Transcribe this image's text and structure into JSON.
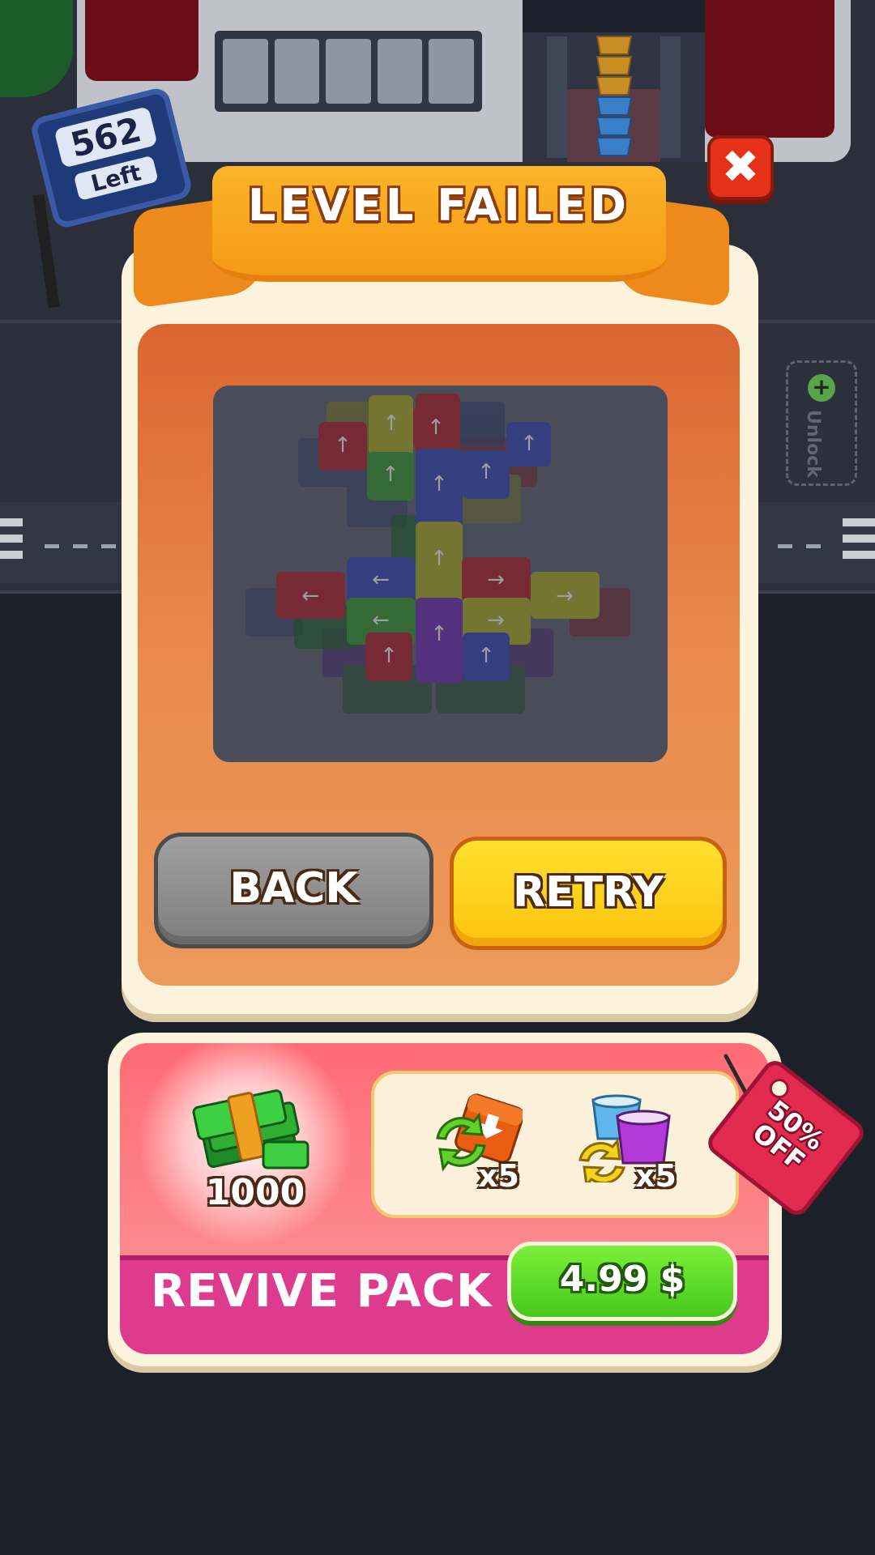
{
  "hud": {
    "counter_value": "562",
    "counter_label": "Left",
    "unlock_label": "Unlock"
  },
  "dialog": {
    "title": "LEVEL FAILED",
    "back_label": "BACK",
    "retry_label": "RETRY"
  },
  "offer": {
    "title": "REVIVE PACK",
    "cash_amount": "1000",
    "items": [
      {
        "icon": "shuffle-block-icon",
        "quantity": "x5"
      },
      {
        "icon": "swap-cups-icon",
        "quantity": "x5"
      }
    ],
    "discount_line1": "50%",
    "discount_line2": "OFF",
    "price": "4.99 $"
  },
  "colors": {
    "ribbon": "#f59a16",
    "close": "#e53118",
    "retry": "#fbc40e",
    "back": "#8a8a8a",
    "price_button": "#46c81c",
    "offer_bar": "#df3b8d",
    "sale_tag": "#e32a4f"
  }
}
